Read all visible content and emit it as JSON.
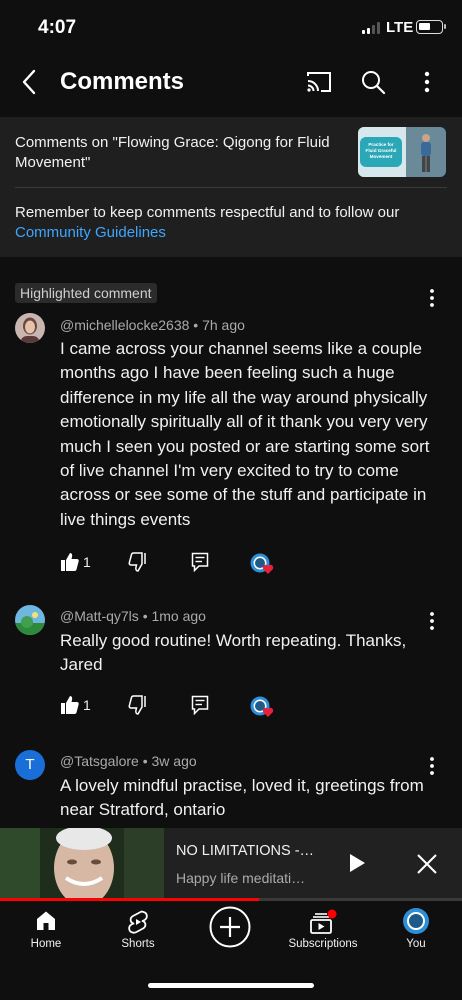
{
  "status_bar": {
    "time": "4:07",
    "network": "LTE",
    "battery_level": 0.55
  },
  "header": {
    "title": "Comments"
  },
  "video_info": {
    "title": "Comments on \"Flowing Grace: Qigong for Fluid Movement\"",
    "thumbnail_text": "Practice for Fluid Graceful Movement",
    "reminder": "Remember to keep comments respectful and to follow our",
    "guidelines_link": "Community Guidelines"
  },
  "comments": [
    {
      "badge": "Highlighted comment",
      "author": "@michellelocke2638",
      "age": "7h ago",
      "text": "I came across your channel seems like a couple months ago I have been feeling such a huge difference in my life all the way around physically emotionally spiritually all of it thank you very very much I seen you posted or are starting some sort of live channel I'm very excited to try to come across or see some of the stuff and participate in live things events",
      "likes": "1"
    },
    {
      "author": "@Matt-qy7ls",
      "age": "1mo ago",
      "text": "Really good routine! Worth repeating. Thanks, Jared",
      "likes": "1"
    },
    {
      "author": "@Tatsgalore",
      "avatar_letter": "T",
      "age": "3w ago",
      "text": "A lovely mindful practise, loved it, greetings from near Stratford, ontario"
    }
  ],
  "separator": "•",
  "mini_player": {
    "title": "NO LIMITATIONS -…",
    "channel": "Happy life meditati…",
    "progress": 0.56
  },
  "nav": {
    "home": "Home",
    "shorts": "Shorts",
    "subscriptions": "Subscriptions",
    "you": "You"
  },
  "colors": {
    "background": "#0f0f0f",
    "link": "#3ea6ff",
    "progress": "#ff0000",
    "heart": "#e8213a"
  }
}
